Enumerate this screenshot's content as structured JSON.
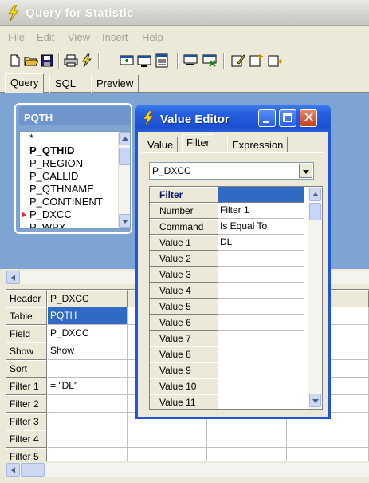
{
  "app": {
    "title": "Query for Statistic"
  },
  "menu": [
    "File",
    "Edit",
    "View",
    "Insert",
    "Help"
  ],
  "main_tabs": [
    "Query",
    "SQL",
    "Preview"
  ],
  "table_box": {
    "name": "PQTH",
    "fields": [
      "*",
      "P_QTHID",
      "P_REGION",
      "P_CALLID",
      "P_QTHNAME",
      "P_CONTINENT",
      "P_DXCC",
      "P_WPX"
    ]
  },
  "grid": {
    "row_labels": [
      "Header",
      "Table",
      "Field",
      "Show",
      "Sort",
      "Filter 1",
      "Filter 2",
      "Filter 3",
      "Filter 4",
      "Filter 5"
    ],
    "column_1": [
      "P_DXCC",
      "PQTH",
      "P_DXCC",
      "Show",
      "",
      "= \"DL\"",
      "",
      "",
      "",
      ""
    ]
  },
  "dialog": {
    "title": "Value Editor",
    "tabs": [
      "Value",
      "Filter",
      "Expression"
    ],
    "combo_value": "P_DXCC",
    "grid_header": "Filter",
    "rows": [
      {
        "label": "Number",
        "value": "Filter 1"
      },
      {
        "label": "Command",
        "value": "Is Equal To"
      },
      {
        "label": "Value 1",
        "value": "DL"
      },
      {
        "label": "Value 2",
        "value": ""
      },
      {
        "label": "Value 3",
        "value": ""
      },
      {
        "label": "Value 4",
        "value": ""
      },
      {
        "label": "Value 5",
        "value": ""
      },
      {
        "label": "Value 6",
        "value": ""
      },
      {
        "label": "Value 7",
        "value": ""
      },
      {
        "label": "Value 8",
        "value": ""
      },
      {
        "label": "Value 9",
        "value": ""
      },
      {
        "label": "Value 10",
        "value": ""
      },
      {
        "label": "Value 11",
        "value": ""
      }
    ]
  },
  "colors": {
    "design_bg": "#7ea4d3",
    "selection": "#316ac5",
    "xp_title": "#1f55d6"
  }
}
